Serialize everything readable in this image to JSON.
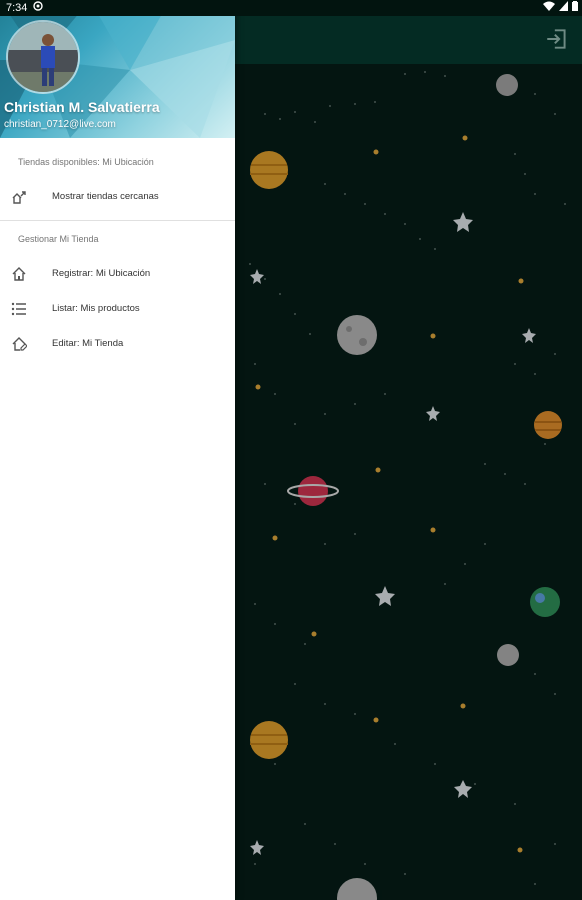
{
  "status_bar": {
    "time": "7:34"
  },
  "user": {
    "name": "Christian M. Salvatierra",
    "email": "christian_0712@live.com"
  },
  "sections": [
    {
      "title": "Tiendas disponibles: Mi Ubicación",
      "items": [
        {
          "label": "Mostrar tiendas cercanas",
          "icon": "nearby-stores-icon"
        }
      ]
    },
    {
      "title": "Gestionar Mi Tienda",
      "items": [
        {
          "label": "Registrar: Mi Ubicación",
          "icon": "home-icon"
        },
        {
          "label": "Listar: Mis productos",
          "icon": "list-icon"
        },
        {
          "label": "Editar: Mi Tienda",
          "icon": "edit-home-icon"
        }
      ]
    }
  ],
  "colors": {
    "appbar": "#06382e",
    "background": "#061b16",
    "drawer_header_start": "#1f7d93",
    "drawer_header_end": "#d3f0f3"
  }
}
